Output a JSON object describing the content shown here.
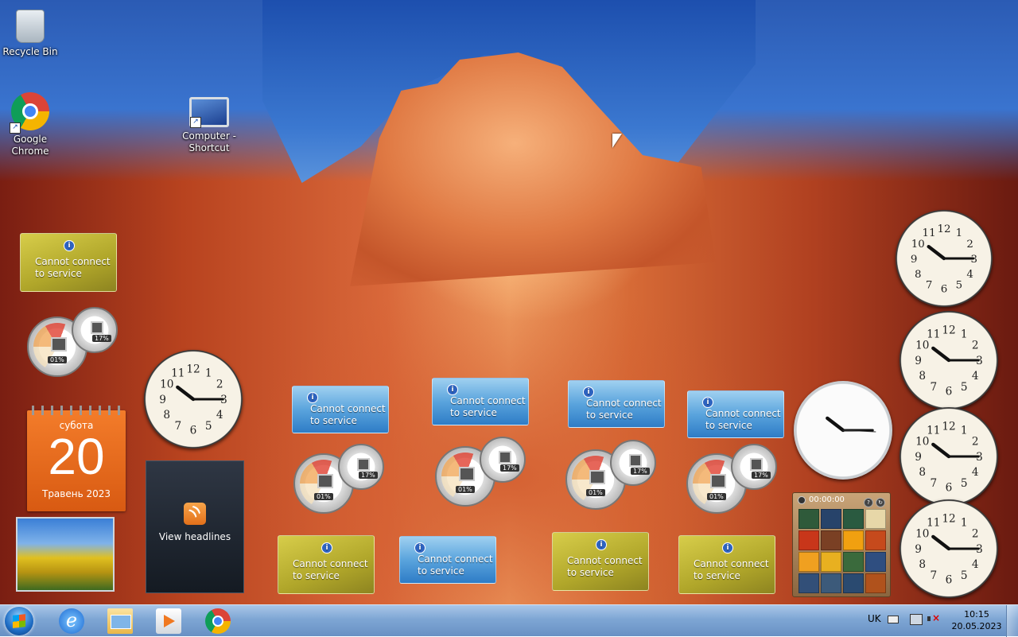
{
  "desktop_icons": {
    "recycle_bin": "Recycle Bin",
    "chrome_line1": "Google",
    "chrome_line2": "Chrome",
    "computer_line1": "Computer -",
    "computer_line2": "Shortcut"
  },
  "weather": {
    "line1": "Cannot connect",
    "line2": "to service"
  },
  "cpu_meter": {
    "cpu_percent": "01%",
    "memory_percent": "17%"
  },
  "calendar": {
    "weekday": "субота",
    "day": "20",
    "month_year": "Травень 2023"
  },
  "feeds": {
    "label": "View headlines"
  },
  "clocks": {
    "hour": 10,
    "minute": 15
  },
  "puzzle": {
    "timer": "00:00:00"
  },
  "taskbar": {
    "language": "UK",
    "time": "10:15",
    "date": "20.05.2023"
  },
  "colors": {
    "taskbar": "#7ea6d4",
    "calendar": "#e8661c",
    "weather_yellow": "#c4ba38",
    "weather_blue": "#5aa4dd"
  }
}
